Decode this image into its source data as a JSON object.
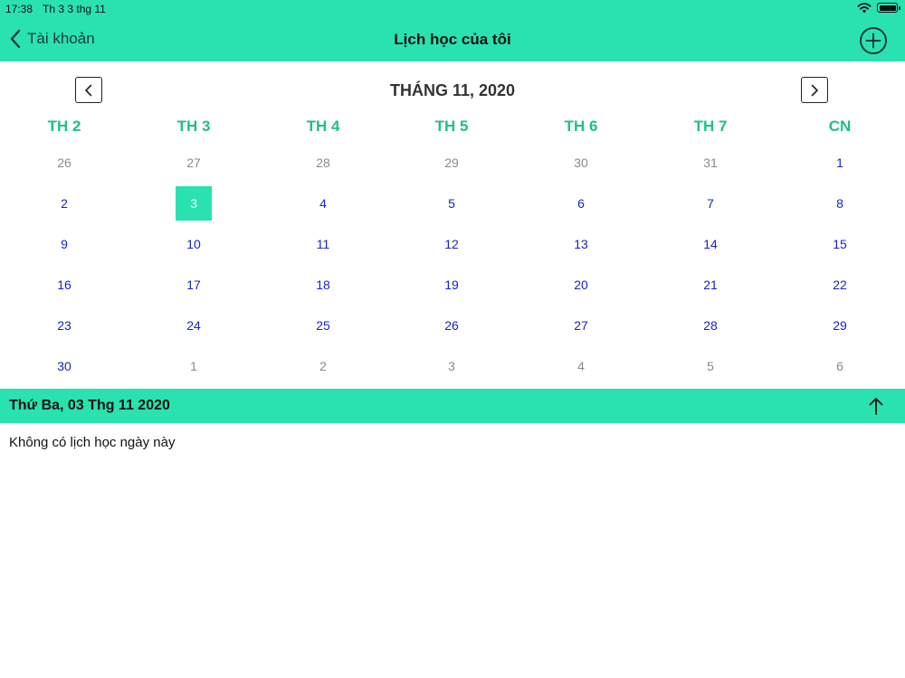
{
  "status_bar": {
    "time": "17:38",
    "date": "Th 3 3 thg 11"
  },
  "nav": {
    "back_label": "Tài khoản",
    "title": "Lịch học của tôi"
  },
  "calendar": {
    "month_title": "THÁNG 11, 2020",
    "weekdays": [
      "TH 2",
      "TH 3",
      "TH 4",
      "TH 5",
      "TH 6",
      "TH 7",
      "CN"
    ],
    "weeks": [
      [
        {
          "d": "26",
          "m": "prev"
        },
        {
          "d": "27",
          "m": "prev"
        },
        {
          "d": "28",
          "m": "prev"
        },
        {
          "d": "29",
          "m": "prev"
        },
        {
          "d": "30",
          "m": "prev"
        },
        {
          "d": "31",
          "m": "prev"
        },
        {
          "d": "1",
          "m": "cur"
        }
      ],
      [
        {
          "d": "2",
          "m": "cur"
        },
        {
          "d": "3",
          "m": "cur",
          "selected": true
        },
        {
          "d": "4",
          "m": "cur"
        },
        {
          "d": "5",
          "m": "cur"
        },
        {
          "d": "6",
          "m": "cur"
        },
        {
          "d": "7",
          "m": "cur"
        },
        {
          "d": "8",
          "m": "cur"
        }
      ],
      [
        {
          "d": "9",
          "m": "cur"
        },
        {
          "d": "10",
          "m": "cur"
        },
        {
          "d": "11",
          "m": "cur"
        },
        {
          "d": "12",
          "m": "cur"
        },
        {
          "d": "13",
          "m": "cur"
        },
        {
          "d": "14",
          "m": "cur"
        },
        {
          "d": "15",
          "m": "cur"
        }
      ],
      [
        {
          "d": "16",
          "m": "cur"
        },
        {
          "d": "17",
          "m": "cur"
        },
        {
          "d": "18",
          "m": "cur"
        },
        {
          "d": "19",
          "m": "cur"
        },
        {
          "d": "20",
          "m": "cur"
        },
        {
          "d": "21",
          "m": "cur"
        },
        {
          "d": "22",
          "m": "cur"
        }
      ],
      [
        {
          "d": "23",
          "m": "cur"
        },
        {
          "d": "24",
          "m": "cur"
        },
        {
          "d": "25",
          "m": "cur"
        },
        {
          "d": "26",
          "m": "cur"
        },
        {
          "d": "27",
          "m": "cur"
        },
        {
          "d": "28",
          "m": "cur"
        },
        {
          "d": "29",
          "m": "cur"
        }
      ],
      [
        {
          "d": "30",
          "m": "cur"
        },
        {
          "d": "1",
          "m": "next"
        },
        {
          "d": "2",
          "m": "next"
        },
        {
          "d": "3",
          "m": "next"
        },
        {
          "d": "4",
          "m": "next"
        },
        {
          "d": "5",
          "m": "next"
        },
        {
          "d": "6",
          "m": "next"
        }
      ]
    ]
  },
  "selected_day": {
    "label": "Thứ Ba, 03 Thg 11 2020",
    "empty_message": "Không có lịch học ngày này"
  },
  "colors": {
    "accent": "#29e2b0",
    "weekday": "#1fbf8a",
    "current_day": "#1a22c8",
    "other_day": "#8a8a8a"
  },
  "icons": [
    "chevron-left-icon",
    "add-circle-icon",
    "arrow-left-icon",
    "arrow-right-icon",
    "arrow-up-icon",
    "wifi-icon",
    "battery-icon"
  ]
}
